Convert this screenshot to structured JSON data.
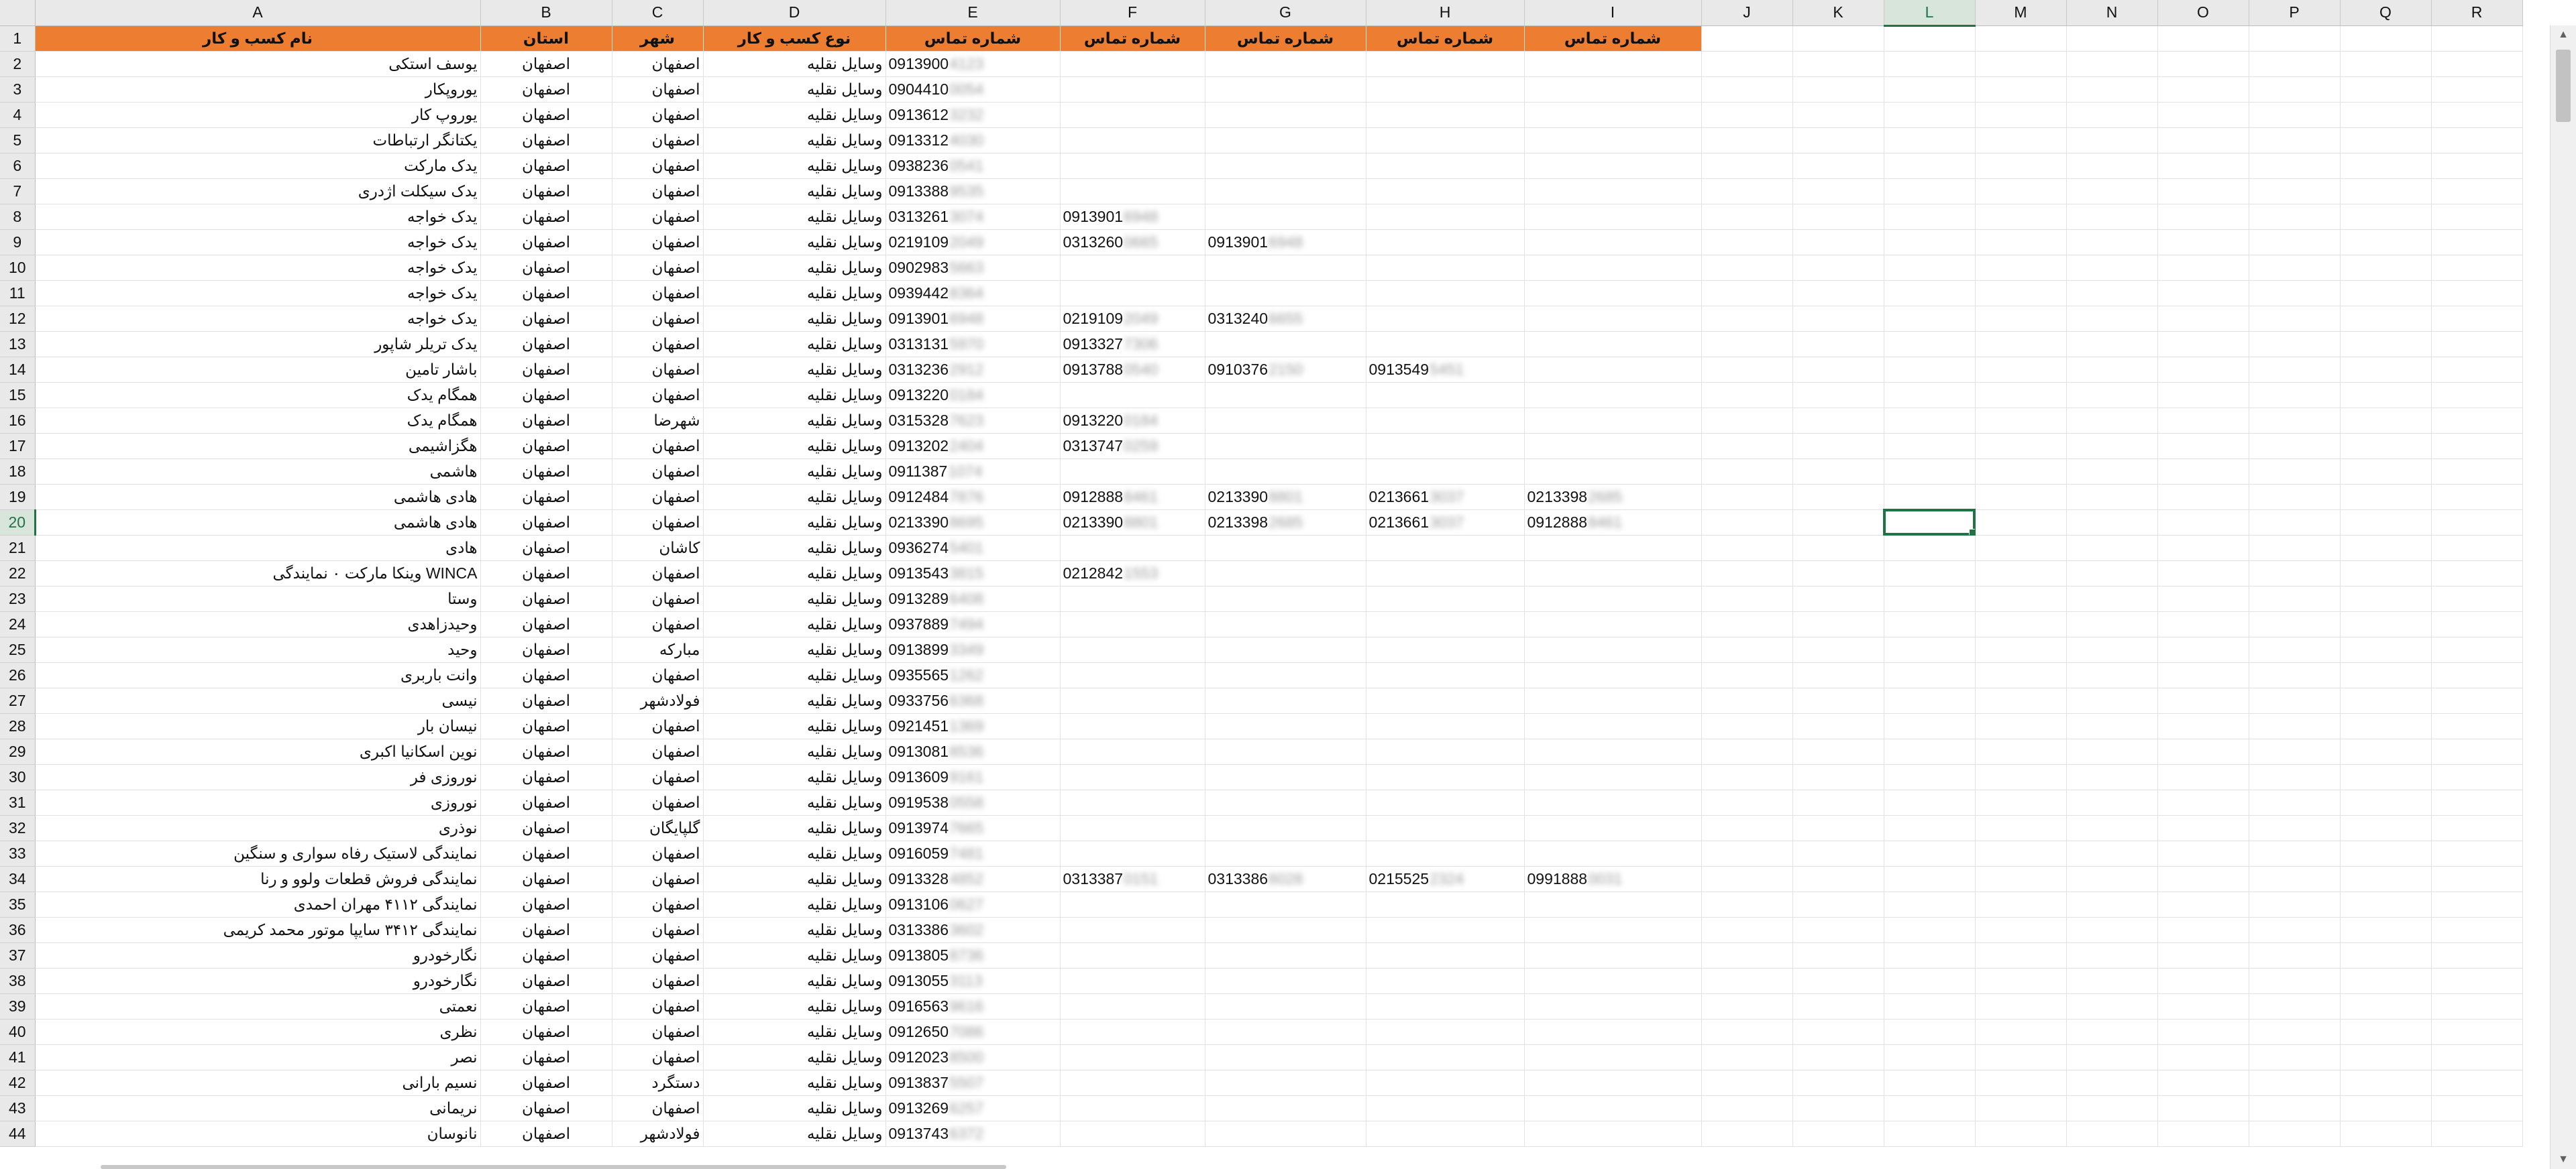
{
  "columns": [
    "A",
    "B",
    "C",
    "D",
    "E",
    "F",
    "G",
    "H",
    "I",
    "J",
    "K",
    "L",
    "M",
    "N",
    "O",
    "P",
    "Q",
    "R"
  ],
  "active_column": "L",
  "active_row": 20,
  "selected_cell": "L20",
  "header_row": [
    "نام کسب و کار",
    "استان",
    "شهر",
    "نوع کسب و کار",
    "شماره تماس",
    "شماره تماس",
    "شماره تماس",
    "شماره تماس",
    "شماره تماس"
  ],
  "rows": [
    {
      "num": "2",
      "name": "یوسف استکی",
      "province": "اصفهان",
      "city": "اصفهان",
      "type": "وسایل نقلیه",
      "phones": [
        [
          "0913900",
          "4123"
        ]
      ]
    },
    {
      "num": "3",
      "name": "یوروپکار",
      "province": "اصفهان",
      "city": "اصفهان",
      "type": "وسایل نقلیه",
      "phones": [
        [
          "0904410",
          "0054"
        ]
      ]
    },
    {
      "num": "4",
      "name": "یوروپ کار",
      "province": "اصفهان",
      "city": "اصفهان",
      "type": "وسایل نقلیه",
      "phones": [
        [
          "0913612",
          "3232"
        ]
      ]
    },
    {
      "num": "5",
      "name": "یکتانگر ارتباطات",
      "province": "اصفهان",
      "city": "اصفهان",
      "type": "وسایل نقلیه",
      "phones": [
        [
          "0913312",
          "4030"
        ]
      ]
    },
    {
      "num": "6",
      "name": "یدک مارکت",
      "province": "اصفهان",
      "city": "اصفهان",
      "type": "وسایل نقلیه",
      "phones": [
        [
          "0938236",
          "0541"
        ]
      ]
    },
    {
      "num": "7",
      "name": "یدک سیکلت اژدری",
      "province": "اصفهان",
      "city": "اصفهان",
      "type": "وسایل نقلیه",
      "phones": [
        [
          "0913388",
          "9535"
        ]
      ]
    },
    {
      "num": "8",
      "name": "یدک خواجه",
      "province": "اصفهان",
      "city": "اصفهان",
      "type": "وسایل نقلیه",
      "phones": [
        [
          "0313261",
          "3074"
        ],
        [
          "0913901",
          "6948"
        ]
      ]
    },
    {
      "num": "9",
      "name": "یدک خواجه",
      "province": "اصفهان",
      "city": "اصفهان",
      "type": "وسایل نقلیه",
      "phones": [
        [
          "0219109",
          "2049"
        ],
        [
          "0313260",
          "0665"
        ],
        [
          "0913901",
          "6948"
        ]
      ]
    },
    {
      "num": "10",
      "name": "یدک خواجه",
      "province": "اصفهان",
      "city": "اصفهان",
      "type": "وسایل نقلیه",
      "phones": [
        [
          "0902983",
          "5663"
        ]
      ]
    },
    {
      "num": "11",
      "name": "یدک خواجه",
      "province": "اصفهان",
      "city": "اصفهان",
      "type": "وسایل نقلیه",
      "phones": [
        [
          "0939442",
          "8364"
        ]
      ]
    },
    {
      "num": "12",
      "name": "یدک خواجه",
      "province": "اصفهان",
      "city": "اصفهان",
      "type": "وسایل نقلیه",
      "phones": [
        [
          "0913901",
          "6948"
        ],
        [
          "0219109",
          "2049"
        ],
        [
          "0313240",
          "6655"
        ]
      ]
    },
    {
      "num": "13",
      "name": "یدک تریلر شاپور",
      "province": "اصفهان",
      "city": "اصفهان",
      "type": "وسایل نقلیه",
      "phones": [
        [
          "0313131",
          "5970"
        ],
        [
          "0913327",
          "7306"
        ]
      ]
    },
    {
      "num": "14",
      "name": "باشار تامین",
      "province": "اصفهان",
      "city": "اصفهان",
      "type": "وسایل نقلیه",
      "phones": [
        [
          "0313236",
          "2912"
        ],
        [
          "0913788",
          "0540"
        ],
        [
          "0910376",
          "2150"
        ],
        [
          "0913549",
          "5451"
        ]
      ]
    },
    {
      "num": "15",
      "name": "همگام یدک",
      "province": "اصفهان",
      "city": "اصفهان",
      "type": "وسایل نقلیه",
      "phones": [
        [
          "0913220",
          "0184"
        ]
      ]
    },
    {
      "num": "16",
      "name": "همگام یدک",
      "province": "اصفهان",
      "city": "شهرضا",
      "type": "وسایل نقلیه",
      "phones": [
        [
          "0315328",
          "7623"
        ],
        [
          "0913220",
          "0184"
        ]
      ]
    },
    {
      "num": "17",
      "name": "هگزاشیمی",
      "province": "اصفهان",
      "city": "اصفهان",
      "type": "وسایل نقلیه",
      "phones": [
        [
          "0913202",
          "2404"
        ],
        [
          "0313747",
          "0259"
        ]
      ]
    },
    {
      "num": "18",
      "name": "هاشمی",
      "province": "اصفهان",
      "city": "اصفهان",
      "type": "وسایل نقلیه",
      "phones": [
        [
          "0911387",
          "1074"
        ]
      ]
    },
    {
      "num": "19",
      "name": "هادی هاشمی",
      "province": "اصفهان",
      "city": "اصفهان",
      "type": "وسایل نقلیه",
      "phones": [
        [
          "0912484",
          "7876"
        ],
        [
          "0912888",
          "8461"
        ],
        [
          "0213390",
          "8801"
        ],
        [
          "0213661",
          "3037"
        ],
        [
          "0213398",
          "2685"
        ]
      ]
    },
    {
      "num": "20",
      "name": "هادی هاشمی",
      "province": "اصفهان",
      "city": "اصفهان",
      "type": "وسایل نقلیه",
      "phones": [
        [
          "0213390",
          "8695"
        ],
        [
          "0213390",
          "8801"
        ],
        [
          "0213398",
          "2685"
        ],
        [
          "0213661",
          "3037"
        ],
        [
          "0912888",
          "8461"
        ]
      ]
    },
    {
      "num": "21",
      "name": "هادی",
      "province": "اصفهان",
      "city": "کاشان",
      "type": "وسایل نقلیه",
      "phones": [
        [
          "0936274",
          "5401"
        ]
      ]
    },
    {
      "num": "22",
      "name": "وینکا مارکت ۰ نمایندگی WINCA",
      "province": "اصفهان",
      "city": "اصفهان",
      "type": "وسایل نقلیه",
      "phones": [
        [
          "0913543",
          "3815"
        ],
        [
          "0212842",
          "1553"
        ]
      ]
    },
    {
      "num": "23",
      "name": "وستا",
      "province": "اصفهان",
      "city": "اصفهان",
      "type": "وسایل نقلیه",
      "phones": [
        [
          "0913289",
          "6408"
        ]
      ]
    },
    {
      "num": "24",
      "name": "وحیدزاهدی",
      "province": "اصفهان",
      "city": "اصفهان",
      "type": "وسایل نقلیه",
      "phones": [
        [
          "0937889",
          "7494"
        ]
      ]
    },
    {
      "num": "25",
      "name": "وحید",
      "province": "اصفهان",
      "city": "مبارکه",
      "type": "وسایل نقلیه",
      "phones": [
        [
          "0913899",
          "3349"
        ]
      ]
    },
    {
      "num": "26",
      "name": "وانت باربری",
      "province": "اصفهان",
      "city": "اصفهان",
      "type": "وسایل نقلیه",
      "phones": [
        [
          "0935565",
          "1262"
        ]
      ]
    },
    {
      "num": "27",
      "name": "نیسی",
      "province": "اصفهان",
      "city": "فولادشهر",
      "type": "وسایل نقلیه",
      "phones": [
        [
          "0933756",
          "6368"
        ]
      ]
    },
    {
      "num": "28",
      "name": "نیسان بار",
      "province": "اصفهان",
      "city": "اصفهان",
      "type": "وسایل نقلیه",
      "phones": [
        [
          "0921451",
          "1369"
        ]
      ]
    },
    {
      "num": "29",
      "name": "نوین اسکانیا اکبری",
      "province": "اصفهان",
      "city": "اصفهان",
      "type": "وسایل نقلیه",
      "phones": [
        [
          "0913081",
          "8536"
        ]
      ]
    },
    {
      "num": "30",
      "name": "نوروزی فر",
      "province": "اصفهان",
      "city": "اصفهان",
      "type": "وسایل نقلیه",
      "phones": [
        [
          "0913609",
          "9161"
        ]
      ]
    },
    {
      "num": "31",
      "name": "نوروزی",
      "province": "اصفهان",
      "city": "اصفهان",
      "type": "وسایل نقلیه",
      "phones": [
        [
          "0919538",
          "0558"
        ]
      ]
    },
    {
      "num": "32",
      "name": "نوذری",
      "province": "اصفهان",
      "city": "گلپایگان",
      "type": "وسایل نقلیه",
      "phones": [
        [
          "0913974",
          "7665"
        ]
      ]
    },
    {
      "num": "33",
      "name": "نمایندگی لاستیک رفاه سواری و سنگین",
      "province": "اصفهان",
      "city": "اصفهان",
      "type": "وسایل نقلیه",
      "phones": [
        [
          "0916059",
          "7481"
        ]
      ]
    },
    {
      "num": "34",
      "name": "نمایندگی فروش قطعات ولوو و رنا",
      "province": "اصفهان",
      "city": "اصفهان",
      "type": "وسایل نقلیه",
      "phones": [
        [
          "0913328",
          "4852"
        ],
        [
          "0313387",
          "0151"
        ],
        [
          "0313386",
          "6028"
        ],
        [
          "0215525",
          "2324"
        ],
        [
          "0991888",
          "0031"
        ]
      ]
    },
    {
      "num": "35",
      "name": "نمایندگی ۴۱۱۲ مهران احمدی",
      "province": "اصفهان",
      "city": "اصفهان",
      "type": "وسایل نقلیه",
      "phones": [
        [
          "0913106",
          "0627"
        ]
      ]
    },
    {
      "num": "36",
      "name": "نمایندگی ۳۴۱۲ سایپا موتور محمد کریمی",
      "province": "اصفهان",
      "city": "اصفهان",
      "type": "وسایل نقلیه",
      "phones": [
        [
          "0313386",
          "3602"
        ]
      ]
    },
    {
      "num": "37",
      "name": "نگارخودرو",
      "province": "اصفهان",
      "city": "اصفهان",
      "type": "وسایل نقلیه",
      "phones": [
        [
          "0913805",
          "8736"
        ]
      ]
    },
    {
      "num": "38",
      "name": "نگارخودرو",
      "province": "اصفهان",
      "city": "اصفهان",
      "type": "وسایل نقلیه",
      "phones": [
        [
          "0913055",
          "3113"
        ]
      ]
    },
    {
      "num": "39",
      "name": "نعمتی",
      "province": "اصفهان",
      "city": "اصفهان",
      "type": "وسایل نقلیه",
      "phones": [
        [
          "0916563",
          "9616"
        ]
      ]
    },
    {
      "num": "40",
      "name": "نظری",
      "province": "اصفهان",
      "city": "اصفهان",
      "type": "وسایل نقلیه",
      "phones": [
        [
          "0912650",
          "7086"
        ]
      ]
    },
    {
      "num": "41",
      "name": "نصر",
      "province": "اصفهان",
      "city": "اصفهان",
      "type": "وسایل نقلیه",
      "phones": [
        [
          "0912023",
          "8500"
        ]
      ]
    },
    {
      "num": "42",
      "name": "نسیم بارانی",
      "province": "اصفهان",
      "city": "دستگرد",
      "type": "وسایل نقلیه",
      "phones": [
        [
          "0913837",
          "5507"
        ]
      ]
    },
    {
      "num": "43",
      "name": "نریمانی",
      "province": "اصفهان",
      "city": "اصفهان",
      "type": "وسایل نقلیه",
      "phones": [
        [
          "0913269",
          "6257"
        ]
      ]
    },
    {
      "num": "44",
      "name": "نانوسان",
      "province": "اصفهان",
      "city": "فولادشهر",
      "type": "وسایل نقلیه",
      "phones": [
        [
          "0913743",
          "6372"
        ]
      ]
    }
  ]
}
